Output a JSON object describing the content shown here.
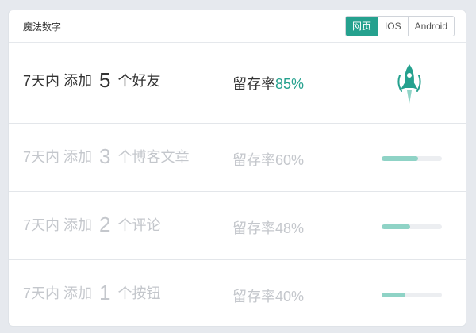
{
  "header": {
    "title": "魔法数字",
    "tabs": [
      {
        "label": "网页",
        "active": true
      },
      {
        "label": "IOS",
        "active": false
      },
      {
        "label": "Android",
        "active": false
      }
    ]
  },
  "rows": [
    {
      "prefix": "7天内 添加",
      "count": "5",
      "suffix": "个好友",
      "retention_label": "留存率",
      "rate": "85%",
      "progress": 0.85,
      "indicator": "rocket-icon"
    },
    {
      "prefix": "7天内 添加",
      "count": "3",
      "suffix": "个博客文章",
      "retention_label": "留存率",
      "rate": "60%",
      "progress": 0.6
    },
    {
      "prefix": "7天内 添加",
      "count": "2",
      "suffix": "个评论",
      "retention_label": "留存率",
      "rate": "48%",
      "progress": 0.48
    },
    {
      "prefix": "7天内 添加",
      "count": "1",
      "suffix": "个按钮",
      "retention_label": "留存率",
      "rate": "40%",
      "progress": 0.4
    }
  ],
  "colors": {
    "accent": "#25a18e",
    "bar_fill": "#8fd3c6",
    "bar_track": "#eceef1",
    "muted_text": "#c4c7cc",
    "primary_text": "#333333"
  }
}
